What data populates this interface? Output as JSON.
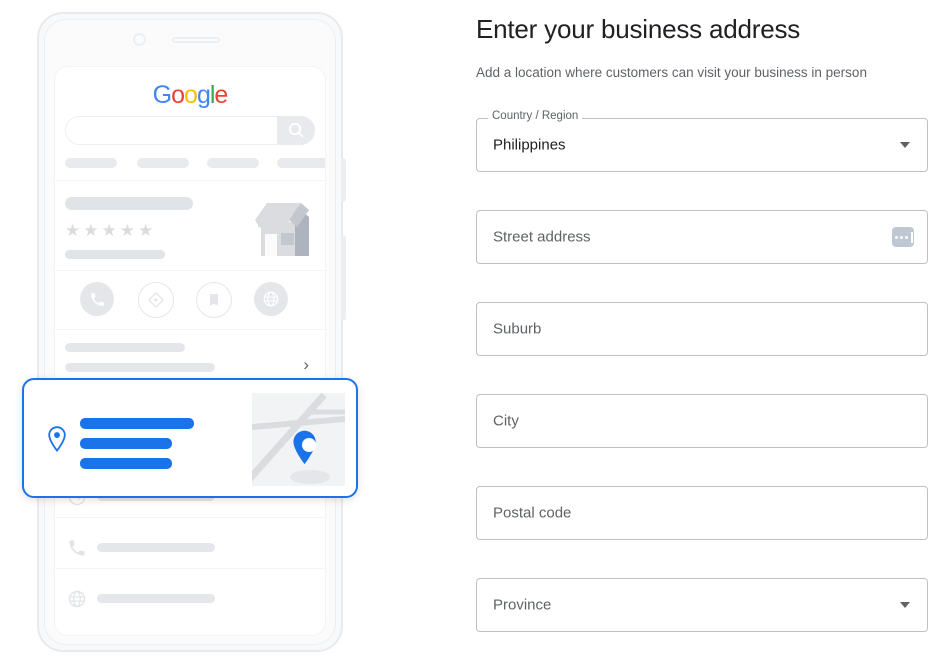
{
  "form": {
    "title": "Enter your business address",
    "subtitle": "Add a location where customers can visit your business in person",
    "fields": [
      {
        "name": "country-region",
        "label": "Country / Region",
        "value": "Philippines",
        "placeholder": "",
        "has_dropdown": true,
        "has_autofill_icon": false
      },
      {
        "name": "street-address",
        "label": "",
        "value": "",
        "placeholder": "Street address",
        "has_dropdown": false,
        "has_autofill_icon": true
      },
      {
        "name": "suburb",
        "label": "",
        "value": "",
        "placeholder": "Suburb",
        "has_dropdown": false,
        "has_autofill_icon": false
      },
      {
        "name": "city",
        "label": "",
        "value": "",
        "placeholder": "City",
        "has_dropdown": false,
        "has_autofill_icon": false
      },
      {
        "name": "postal-code",
        "label": "",
        "value": "",
        "placeholder": "Postal code",
        "has_dropdown": false,
        "has_autofill_icon": false
      },
      {
        "name": "province",
        "label": "",
        "value": "",
        "placeholder": "Province",
        "has_dropdown": true,
        "has_autofill_icon": false
      }
    ]
  },
  "illustration": {
    "google_logo": {
      "letters": [
        {
          "char": "G",
          "color": "#4285f4"
        },
        {
          "char": "o",
          "color": "#ea4335"
        },
        {
          "char": "o",
          "color": "#fbbc05"
        },
        {
          "char": "g",
          "color": "#4285f4"
        },
        {
          "char": "l",
          "color": "#34a853"
        },
        {
          "char": "e",
          "color": "#ea4335"
        }
      ]
    },
    "search": {
      "placeholder": "",
      "icon": "search-icon"
    },
    "rating_stars": "★★★★★",
    "action_icons": [
      "call-icon",
      "directions-icon",
      "bookmark-icon",
      "website-icon"
    ],
    "detail_rows": [
      "hours-clock-icon",
      "phone-icon",
      "website-globe-icon"
    ],
    "highlight_card": {
      "pin_icon": "location-pin-icon",
      "map_pin_icon": "map-marker-icon",
      "accent_color": "#1a73e8"
    },
    "chevron": "›"
  },
  "colors": {
    "accent_blue": "#1a73e8",
    "text_primary": "#202124",
    "text_secondary": "#5f6368",
    "border": "#bdc1c6",
    "placeholder_grey": "#e8eaed"
  }
}
